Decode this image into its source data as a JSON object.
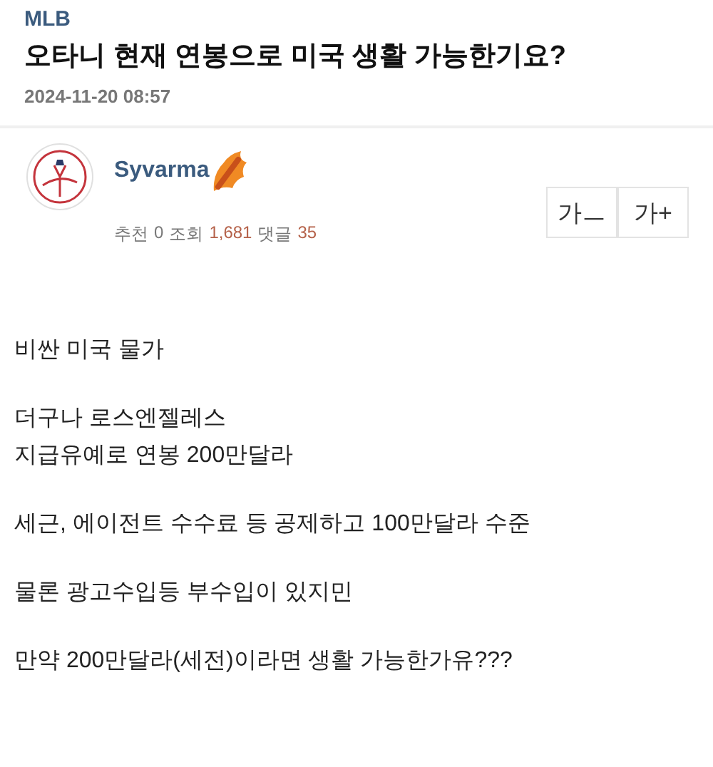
{
  "category": "MLB",
  "title": "오타니 현재 연봉으로 미국 생활 가능한기요?",
  "date": "2024-11-20 08:57",
  "author": {
    "name": "Syvarma"
  },
  "stats": [
    {
      "label": "추천",
      "value": "0",
      "highlight": false
    },
    {
      "label": "조회",
      "value": "1,681",
      "highlight": true
    },
    {
      "label": "댓글",
      "value": "35",
      "highlight": true
    }
  ],
  "font_buttons": [
    "가ㅡ",
    "가+"
  ],
  "paragraphs": [
    [
      "비싼 미국 물가"
    ],
    [
      "더구나 로스엔젤레스",
      "지급유예로 연봉 200만달라"
    ],
    [
      "세근, 에이전트 수수료 등 공제하고 100만달라 수준"
    ],
    [
      "물론 광고수입등 부수입이 있지민"
    ],
    [
      "만약 200만달라(세전)이라면 생활 가능한가유???"
    ]
  ]
}
